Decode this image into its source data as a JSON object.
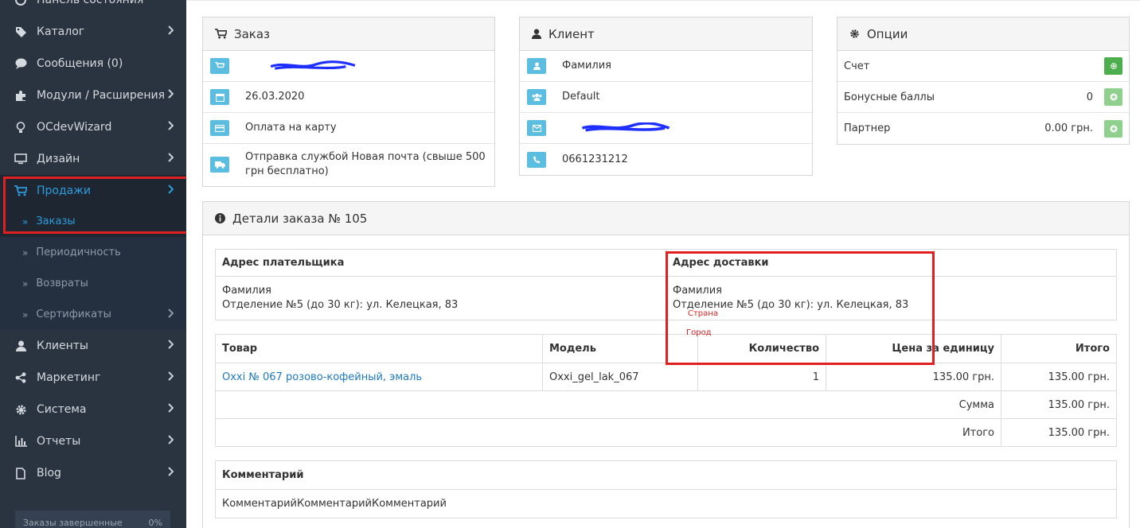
{
  "sidebar": {
    "items": [
      {
        "label": "Панель состояния",
        "icon": "dashboard-icon"
      },
      {
        "label": "Каталог",
        "icon": "tags-icon"
      },
      {
        "label": "Сообщения (0)",
        "icon": "comment-icon"
      },
      {
        "label": "Модули / Расширения",
        "icon": "puzzle-icon"
      },
      {
        "label": "OCdevWizard",
        "icon": "bulb-icon"
      },
      {
        "label": "Дизайн",
        "icon": "monitor-icon"
      },
      {
        "label": "Продажи",
        "icon": "cart-icon"
      }
    ],
    "sub_items": [
      {
        "label": "Заказы"
      },
      {
        "label": "Периодичность"
      },
      {
        "label": "Возвраты"
      },
      {
        "label": "Сертификаты"
      }
    ],
    "items_after": [
      {
        "label": "Клиенты",
        "icon": "user-icon"
      },
      {
        "label": "Маркетинг",
        "icon": "share-icon"
      },
      {
        "label": "Система",
        "icon": "cog-icon"
      },
      {
        "label": "Отчеты",
        "icon": "bar-chart-icon"
      },
      {
        "label": "Blog",
        "icon": "file-icon"
      }
    ],
    "progress": {
      "label": "Заказы завершенные",
      "value": "0%"
    }
  },
  "order_panel": {
    "title": "Заказ",
    "date": "26.03.2020",
    "payment": "Оплата на карту",
    "shipping": "Отправка службой Новая почта (свыше 500 грн бесплатно)"
  },
  "client_panel": {
    "title": "Клиент",
    "lastname": "Фамилия",
    "group": "Default",
    "phone": "0661231212"
  },
  "options_panel": {
    "title": "Опции",
    "rows": [
      {
        "label": "Счет",
        "value": ""
      },
      {
        "label": "Бонусные баллы",
        "value": "0"
      },
      {
        "label": "Партнер",
        "value": "0.00 грн."
      }
    ]
  },
  "details": {
    "title": "Детали заказа № 105",
    "payment_address_head": "Адрес плательщика",
    "shipping_address_head": "Адрес доставки",
    "payment_address": [
      "Фамилия",
      "Отделение №5 (до 30 кг): ул. Келецкая, 83"
    ],
    "shipping_address": [
      "Фамилия",
      "Отделение №5 (до 30 кг): ул. Келецкая, 83"
    ],
    "notes": {
      "country": "Страна",
      "city": "Город"
    },
    "products_head": {
      "product": "Товар",
      "model": "Модель",
      "qty": "Количество",
      "price": "Цена за единицу",
      "total": "Итого"
    },
    "products": [
      {
        "name": "Oxxi № 067 розово-кофейный, эмаль",
        "model": "Oxxi_gel_lak_067",
        "qty": "1",
        "price": "135.00 грн.",
        "total": "135.00 грн."
      }
    ],
    "totals": [
      {
        "label": "Сумма",
        "value": "135.00 грн."
      },
      {
        "label": "Итого",
        "value": "135.00 грн."
      }
    ],
    "comment_head": "Комментарий",
    "comment": "КомментарийКомментарийКомментарий"
  },
  "colors": {
    "accent": "#2e9bdc",
    "sidebar_bg": "#2a3441",
    "annotation": "#e02020",
    "badge": "#5bbde0",
    "success": "#4cae4c"
  }
}
